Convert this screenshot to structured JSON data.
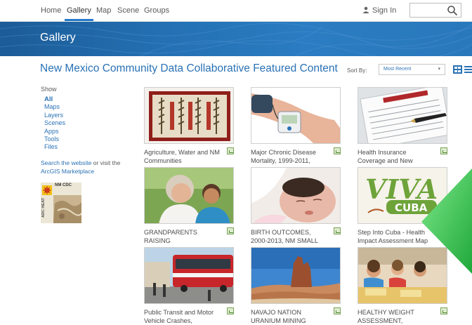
{
  "topnav": {
    "items": [
      {
        "label": "Home"
      },
      {
        "label": "Gallery"
      },
      {
        "label": "Map"
      },
      {
        "label": "Scene"
      },
      {
        "label": "Groups"
      }
    ],
    "active": "Gallery",
    "signin_label": "Sign In",
    "search_placeholder": ""
  },
  "banner": {
    "title": "Gallery"
  },
  "group": {
    "title": "New Mexico Community Data Collaborative Featured Content"
  },
  "sort": {
    "label": "Sort By:",
    "selected": "Most Recent"
  },
  "sidebar": {
    "show_label": "Show",
    "filters": [
      "All",
      "Maps",
      "Layers",
      "Scenes",
      "Apps",
      "Tools",
      "Files"
    ],
    "active_filter": "All",
    "website_prefix": "Search the website",
    "website_middle": " or visit the ",
    "marketplace_link": "ArcGIS Marketplace",
    "logo_text": "NM CDC",
    "logo_side_text": "ARC HEAT"
  },
  "cards": [
    {
      "title": "Agriculture, Water and NM Communities",
      "thumb": "rug"
    },
    {
      "title": "Major Chronic Disease Mortality, 1999-2011,",
      "thumb": "blood-pressure"
    },
    {
      "title": "Health Insurance Coverage and New",
      "thumb": "health-form"
    },
    {
      "title": "GRANDPARENTS RAISING",
      "thumb": "grandparent"
    },
    {
      "title": "BIRTH OUTCOMES, 2000-2013, NM SMALL",
      "thumb": "baby"
    },
    {
      "title": "Step Into Cuba - Health Impact Assessment Map",
      "thumb": "viva-cuba",
      "thumb_text_1": "VIVA",
      "thumb_text_2": "CUBA"
    },
    {
      "title": "Public Transit and Motor Vehicle Crashes,",
      "thumb": "bus"
    },
    {
      "title": "NAVAJO NATION URANIUM MINING",
      "thumb": "mesa"
    },
    {
      "title": "HEALTHY WEIGHT ASSESSMENT,",
      "thumb": "kids"
    }
  ],
  "colors": {
    "brand_blue": "#2a72b5",
    "banner_blue": "#2470b3",
    "arrow_green": "#2fbf45"
  }
}
